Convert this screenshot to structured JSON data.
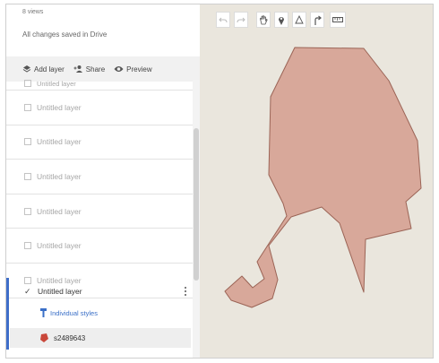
{
  "header": {
    "views": "8 views",
    "save_status": "All changes saved in Drive"
  },
  "actions": {
    "add_layer": "Add layer",
    "share": "Share",
    "preview": "Preview"
  },
  "layers": [
    {
      "label": "Untitled layer",
      "checked": false
    },
    {
      "label": "Untitled layer",
      "checked": false
    },
    {
      "label": "Untitled layer",
      "checked": false
    },
    {
      "label": "Untitled layer",
      "checked": false
    },
    {
      "label": "Untitled layer",
      "checked": false
    },
    {
      "label": "Untitled layer",
      "checked": false
    },
    {
      "label": "Untitled layer",
      "checked": false
    }
  ],
  "active_layer": {
    "label": "Untitled layer",
    "checked": true,
    "style_link": "Individual styles",
    "feature_name": "s2489643"
  },
  "toolbar": {
    "tools": [
      "undo-icon",
      "redo-icon",
      "hand-icon",
      "marker-icon",
      "draw-line-icon",
      "directions-icon",
      "ruler-icon"
    ]
  },
  "colors": {
    "polygon_fill": "#d8a89a",
    "polygon_stroke": "#9b6456",
    "accent": "#3f6ec9",
    "feature_icon": "#c9473a"
  }
}
